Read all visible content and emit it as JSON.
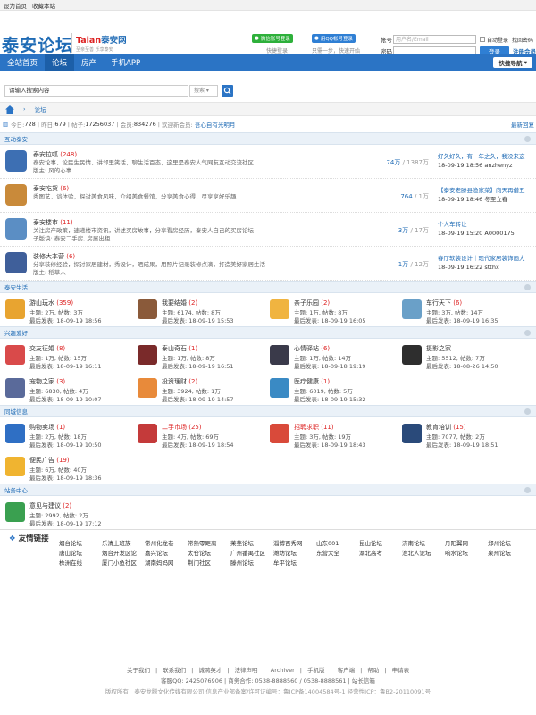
{
  "topbar": {
    "set_home": "设为首页",
    "bookmark": "收藏本站"
  },
  "header": {
    "logo": "泰安论坛",
    "logo2_brand": "Taian",
    "logo2_name": "泰安网",
    "logo2_slogan": "至亲至善  乐享泰安",
    "wechat_btn": "微信账号登录",
    "wechat_caption": "快捷登录",
    "qq_btn": "用QQ帐号登录",
    "qq_caption": "只需一步，快速开始",
    "account_label": "帐号",
    "account_placeholder": "用户名/Email",
    "password_label": "密码",
    "auto_login": "自动登录",
    "forgot": "找回密码",
    "login_btn": "登录",
    "register": "注册会员"
  },
  "nav": {
    "items": [
      "全站首页",
      "论坛",
      "房产",
      "手机APP"
    ],
    "quick": "快捷导航"
  },
  "search": {
    "placeholder": "请输入搜索内容",
    "type": "搜索"
  },
  "breadcrumb": {
    "current": "论坛"
  },
  "stats": {
    "today_label": "今日:",
    "today": "728",
    "yesterday_label": "昨日:",
    "yesterday": "679",
    "posts_label": "帖子:",
    "posts": "17256037",
    "members_label": "会员:",
    "members": "834276",
    "welcome": "欢迎新会员:",
    "new_member": "吾心自有光明月",
    "latest": "最新回复"
  },
  "sections": {
    "s1": {
      "title": "互动泰安",
      "forums": [
        {
          "name": "泰安拉呱",
          "count": "(248)",
          "desc1": "泰安论事、论民生民情、讲邻里笑话，聊生活百态，这里是泰安人气网友互动交流社区",
          "desc2": "版主: 风的心事",
          "stats": "74万",
          "stats2": "/ 1387万",
          "last": "好久好久，有一年之久，我没来这",
          "last_time": "18-09-19 18:56 anzhenyz",
          "color": "#3d6fb3"
        },
        {
          "name": "泰安吃货",
          "count": "(6)",
          "desc1": "秀图艺、谈体验，探讨美食风味，介绍美食餐馆，分享美食心得，尽享享好乐趣",
          "desc2": "",
          "stats": "764",
          "stats2": "/ 1万",
          "last": "【泰安老滕县渔家菜】向天再借五",
          "last_time": "18-09-19 18:46 冬至立春",
          "color": "#c98a3a"
        },
        {
          "name": "泰安楼市",
          "count": "(11)",
          "desc1": "关注房产政策，速递楼市资讯，讲述买房故事，分享看房经历，泰安人自己的买房论坛",
          "desc2": "子版块: 泰安二手房, 房屋出租",
          "stats": "3万",
          "stats2": "/ 17万",
          "last": "个人车转让",
          "last_time": "18-09-19 15:20 A0000175",
          "color": "#5b8ec4"
        },
        {
          "name": "装修大本营",
          "count": "(6)",
          "desc1": "分享装修经验，探讨家居建材，秀设计，晒成果，用照片记录装修点滴，打造美好家居生活",
          "desc2": "版主: 稻草人",
          "stats": "1万",
          "stats2": "/ 12万",
          "last": "春厅软装设计｜现代家居装饰画大",
          "last_time": "18-09-19 16:22 stthx",
          "color": "#3f5f9a"
        }
      ]
    },
    "s2": {
      "title": "泰安生活",
      "forums": [
        {
          "name": "游山玩水",
          "count": "(359)",
          "l1": "主题: 2万, 帖数: 3万",
          "l2": "最后发表: 18-09-19 18:56",
          "color": "#e8a430"
        },
        {
          "name": "我要结婚",
          "count": "(2)",
          "l1": "主题: 6174, 帖数: 8万",
          "l2": "最后发表: 18-09-19 15:53",
          "color": "#8a5a3a"
        },
        {
          "name": "亲子乐园",
          "count": "(2)",
          "l1": "主题: 1万, 帖数: 8万",
          "l2": "最后发表: 18-09-19 16:05",
          "color": "#f0b440"
        },
        {
          "name": "车行天下",
          "count": "(6)",
          "l1": "主题: 3万, 帖数: 14万",
          "l2": "最后发表: 18-09-19 16:35",
          "color": "#6aa0c8"
        }
      ]
    },
    "s3": {
      "title": "兴趣爱好",
      "forums": [
        {
          "name": "交友征婚",
          "count": "(8)",
          "l1": "主题: 1万, 帖数: 15万",
          "l2": "最后发表: 18-09-19 16:11",
          "color": "#d94a4a"
        },
        {
          "name": "泰山奇石",
          "count": "(1)",
          "l1": "主题: 1万, 帖数: 8万",
          "l2": "最后发表: 18-09-19 16:51",
          "color": "#7a2a2a"
        },
        {
          "name": "心情驿站",
          "count": "(6)",
          "l1": "主题: 1万, 帖数: 14万",
          "l2": "最后发表: 18-09-18 19:19",
          "color": "#3a3a4a"
        },
        {
          "name": "摄影之家",
          "count": "",
          "l1": "主题: 5512, 帖数: 7万",
          "l2": "最后发表: 18-08-26 14:50",
          "color": "#2e2e2e"
        },
        {
          "name": "宠物之家",
          "count": "(3)",
          "l1": "主题: 6830, 帖数: 4万",
          "l2": "最后发表: 18-09-19 10:07",
          "color": "#5a6a9a"
        },
        {
          "name": "投资理财",
          "count": "(2)",
          "l1": "主题: 3924, 帖数: 1万",
          "l2": "最后发表: 18-09-19 14:57",
          "color": "#e88a3a"
        },
        {
          "name": "医疗健康",
          "count": "(1)",
          "l1": "主题: 6019, 帖数: 5万",
          "l2": "最后发表: 18-09-19 15:32",
          "color": "#3a8ac4"
        },
        {
          "name": "",
          "count": "",
          "l1": "",
          "l2": "",
          "color": "transparent"
        }
      ]
    },
    "s4": {
      "title": "同城信息",
      "forums": [
        {
          "name": "购物卖场",
          "count": "(1)",
          "l1": "主题: 2万, 帖数: 18万",
          "l2": "最后发表: 18-09-19 10:50",
          "color": "#2f6fc4"
        },
        {
          "name": "二手市场",
          "count": "(25)",
          "l1": "主题: 4万, 帖数: 69万",
          "l2": "最后发表: 18-09-19 18:54",
          "color": "#c43a3a",
          "red": true
        },
        {
          "name": "招聘求职",
          "count": "(11)",
          "l1": "主题: 3万, 帖数: 19万",
          "l2": "最后发表: 18-09-19 18:43",
          "color": "#d94a3a",
          "red": true
        },
        {
          "name": "教育培训",
          "count": "(15)",
          "l1": "主题: 7077, 帖数: 2万",
          "l2": "最后发表: 18-09-19 18:51",
          "color": "#2a4a7a"
        },
        {
          "name": "便民广告",
          "count": "(19)",
          "l1": "主题: 6万, 帖数: 40万",
          "l2": "最后发表: 18-09-19 18:36",
          "color": "#f0b430"
        }
      ]
    },
    "s5": {
      "title": "站务中心",
      "forums": [
        {
          "name": "意见与建议",
          "count": "(2)",
          "l1": "主题: 2992, 帖数: 2万",
          "l2": "最后发表: 18-09-19 17:12",
          "color": "#3aa050"
        }
      ]
    }
  },
  "links": {
    "title": "友情链接",
    "items": [
      "烟台论坛",
      "乐清上班族",
      "常州化龙巷",
      "常熟零距离",
      "莱芜论坛",
      "淄博百秀网",
      "山东001",
      "昆山论坛",
      "济南论坛",
      "丹阳翼网",
      "郑州论坛",
      "唐山论坛",
      "烟台开发区论",
      "嘉兴论坛",
      "太仓论坛",
      "广州番禺社区",
      "潍坊论坛",
      "东营大全",
      "湖北高考",
      "淮北人论坛",
      "响水论坛",
      "泉州论坛",
      "株洲在线",
      "厦门小鱼社区",
      "湖南妈妈网",
      "荆门社区",
      "滕州论坛",
      "牟平论坛"
    ]
  },
  "footer": {
    "links": [
      "关于我们",
      "联系我们",
      "诚聘英才",
      "法律声明",
      "Archiver",
      "手机版",
      "客户端",
      "帮助",
      "申请表"
    ],
    "contact": "客服QQ: 2425076906  |  商务合作: 0538-8888560 / 0538-8888561  |  站长信箱",
    "copyright": "版权所有：泰安龙腾文化传媒有限公司 信息产业部备案/许可证编号：鲁ICP备14004584号-1   经营性ICP：鲁B2-20110091号"
  }
}
